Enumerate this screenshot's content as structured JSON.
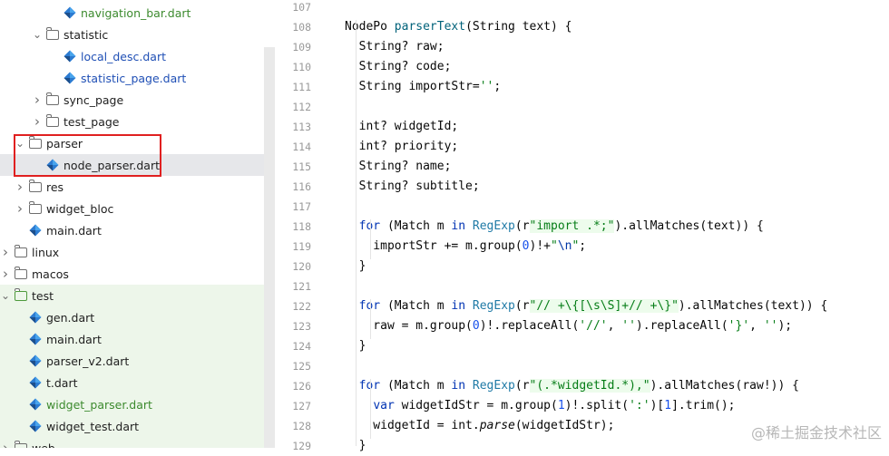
{
  "tree": {
    "items": [
      {
        "label": "navigation_bar.dart",
        "kind": "dart",
        "color": "green"
      },
      {
        "label": "statistic",
        "kind": "folder",
        "expanded": true
      },
      {
        "label": "local_desc.dart",
        "kind": "dart",
        "color": "blue"
      },
      {
        "label": "statistic_page.dart",
        "kind": "dart",
        "color": "blue"
      },
      {
        "label": "sync_page",
        "kind": "folder",
        "expanded": false
      },
      {
        "label": "test_page",
        "kind": "folder",
        "expanded": false
      },
      {
        "label": "parser",
        "kind": "folder",
        "expanded": true
      },
      {
        "label": "node_parser.dart",
        "kind": "dart",
        "color": "normal",
        "selected": true
      },
      {
        "label": "res",
        "kind": "folder",
        "expanded": false
      },
      {
        "label": "widget_bloc",
        "kind": "folder",
        "expanded": false
      },
      {
        "label": "main.dart",
        "kind": "dart",
        "color": "normal"
      },
      {
        "label": "linux",
        "kind": "folder",
        "expanded": false
      },
      {
        "label": "macos",
        "kind": "folder",
        "expanded": false
      },
      {
        "label": "test",
        "kind": "folder-test",
        "expanded": true
      },
      {
        "label": "gen.dart",
        "kind": "dart",
        "color": "normal"
      },
      {
        "label": "main.dart",
        "kind": "dart",
        "color": "normal"
      },
      {
        "label": "parser_v2.dart",
        "kind": "dart",
        "color": "normal"
      },
      {
        "label": "t.dart",
        "kind": "dart",
        "color": "normal"
      },
      {
        "label": "widget_parser.dart",
        "kind": "dart",
        "color": "green"
      },
      {
        "label": "widget_test.dart",
        "kind": "dart",
        "color": "normal"
      },
      {
        "label": "web",
        "kind": "folder",
        "expanded": false
      }
    ]
  },
  "editor": {
    "line_numbers": [
      "107",
      "108",
      "109",
      "110",
      "111",
      "112",
      "113",
      "114",
      "115",
      "116",
      "117",
      "118",
      "119",
      "120",
      "121",
      "122",
      "123",
      "124",
      "125",
      "126",
      "127",
      "128",
      "129"
    ],
    "lines": [
      [],
      [
        [
          "NodePo ",
          ""
        ],
        [
          "parserText",
          "fn"
        ],
        [
          "(String text) {",
          ""
        ]
      ],
      [
        [
          "  String? raw;",
          ""
        ]
      ],
      [
        [
          "  String? code;",
          ""
        ]
      ],
      [
        [
          "  String importStr=",
          ""
        ],
        [
          "''",
          "str"
        ],
        [
          ";",
          ""
        ]
      ],
      [],
      [
        [
          "  int? widgetId;",
          ""
        ]
      ],
      [
        [
          "  int? priority;",
          ""
        ]
      ],
      [
        [
          "  String? name;",
          ""
        ]
      ],
      [
        [
          "  String? subtitle;",
          ""
        ]
      ],
      [],
      [
        [
          "  ",
          ""
        ],
        [
          "for",
          "kw"
        ],
        [
          " (Match m ",
          ""
        ],
        [
          "in",
          "kw"
        ],
        [
          " ",
          ""
        ],
        [
          "RegExp",
          "cls"
        ],
        [
          "(r",
          ""
        ],
        [
          "\"import .*;\"",
          "str regex-bg"
        ],
        [
          ").allMatches(text)) {",
          ""
        ]
      ],
      [
        [
          "    importStr += m.group(",
          ""
        ],
        [
          "0",
          "num"
        ],
        [
          ")!+",
          ""
        ],
        [
          "\"",
          "str"
        ],
        [
          "\\n",
          "esc"
        ],
        [
          "\"",
          "str"
        ],
        [
          ";",
          ""
        ]
      ],
      [
        [
          "  }",
          ""
        ]
      ],
      [],
      [
        [
          "  ",
          ""
        ],
        [
          "for",
          "kw"
        ],
        [
          " (Match m ",
          ""
        ],
        [
          "in",
          "kw"
        ],
        [
          " ",
          ""
        ],
        [
          "RegExp",
          "cls"
        ],
        [
          "(r",
          ""
        ],
        [
          "\"// +\\{[\\s\\S]+// +\\}\"",
          "str regex-bg"
        ],
        [
          ").allMatches(text)) {",
          ""
        ]
      ],
      [
        [
          "    raw = m.group(",
          ""
        ],
        [
          "0",
          "num"
        ],
        [
          ")!.replaceAll(",
          ""
        ],
        [
          "'//'",
          "str"
        ],
        [
          ", ",
          ""
        ],
        [
          "''",
          "str"
        ],
        [
          ").replaceAll(",
          ""
        ],
        [
          "'}'",
          "str"
        ],
        [
          ", ",
          ""
        ],
        [
          "''",
          "str"
        ],
        [
          ");",
          ""
        ]
      ],
      [
        [
          "  }",
          ""
        ]
      ],
      [],
      [
        [
          "  ",
          ""
        ],
        [
          "for",
          "kw"
        ],
        [
          " (Match m ",
          ""
        ],
        [
          "in",
          "kw"
        ],
        [
          " ",
          ""
        ],
        [
          "RegExp",
          "cls"
        ],
        [
          "(r",
          ""
        ],
        [
          "\"(.*widgetId.*),\"",
          "str regex-bg"
        ],
        [
          ").allMatches(raw!)) {",
          ""
        ]
      ],
      [
        [
          "    ",
          ""
        ],
        [
          "var",
          "kw"
        ],
        [
          " widgetIdStr = m.group(",
          ""
        ],
        [
          "1",
          "num"
        ],
        [
          ")!.split(",
          ""
        ],
        [
          "':'",
          "str"
        ],
        [
          ")[",
          ""
        ],
        [
          "1",
          "num"
        ],
        [
          "].trim();",
          ""
        ]
      ],
      [
        [
          "    widgetId = int.",
          ""
        ],
        [
          "parse",
          "italic"
        ],
        [
          "(widgetIdStr);",
          ""
        ]
      ],
      [
        [
          "  }",
          ""
        ]
      ]
    ]
  },
  "watermark": "@稀土掘金技术社区"
}
